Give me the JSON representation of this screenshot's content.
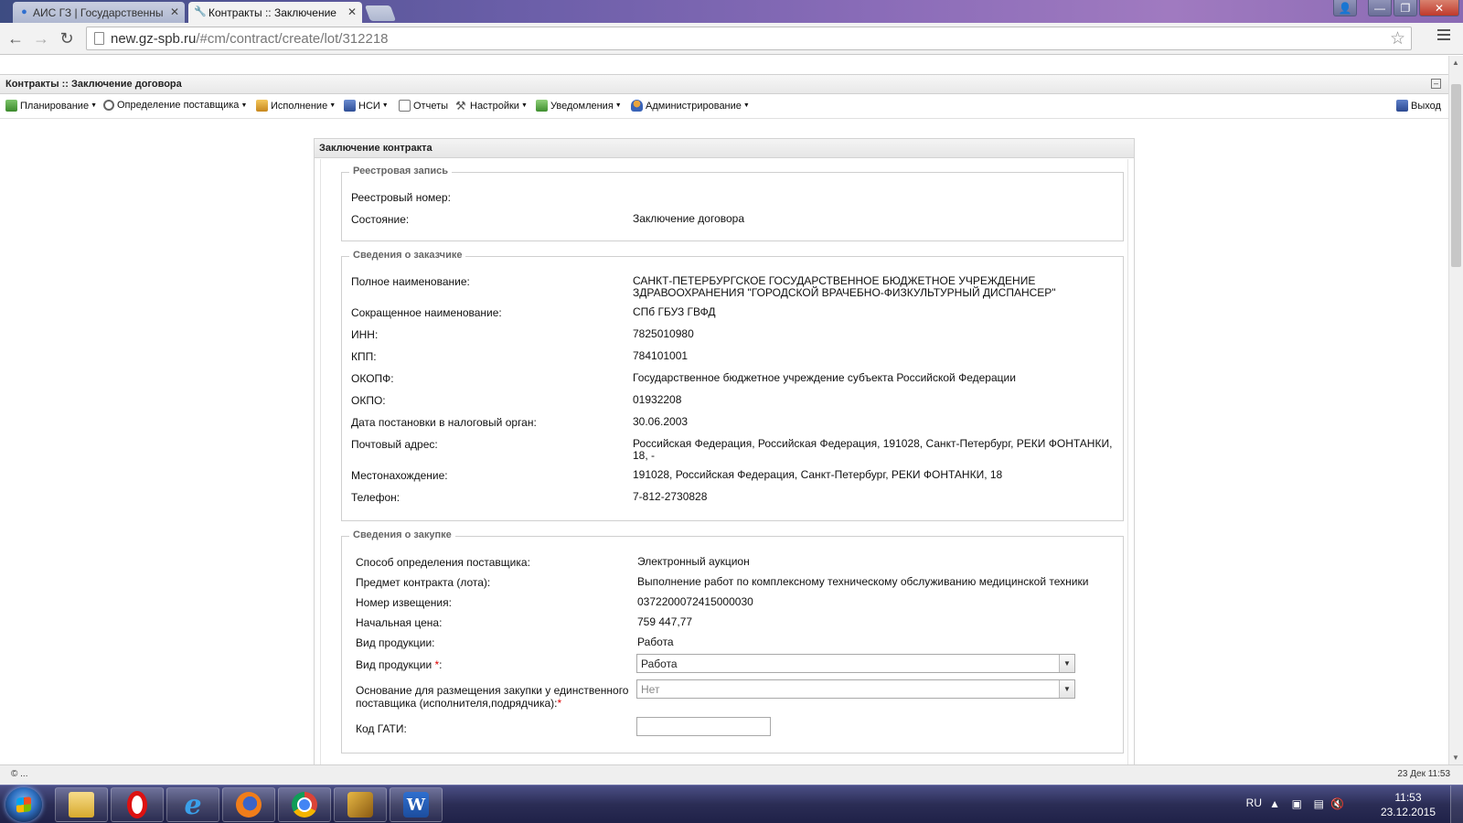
{
  "browser": {
    "tabs": [
      {
        "title": "АИС ГЗ | Государственны",
        "favicon": "globe-icon",
        "active": false
      },
      {
        "title": "Контракты :: Заключение",
        "favicon": "wrench-icon",
        "active": true
      }
    ],
    "url_host": "new.gz-spb.ru",
    "url_path": "/#cm/contract/create/lot/312218"
  },
  "app": {
    "title": "Контракты :: Заключение договора",
    "menu": [
      {
        "label": "Планирование",
        "icon": "planning-icon"
      },
      {
        "label": "Определение поставщика",
        "icon": "gear-icon"
      },
      {
        "label": "Исполнение",
        "icon": "execution-icon"
      },
      {
        "label": "НСИ",
        "icon": "book-icon"
      },
      {
        "label": "Отчеты",
        "icon": "report-icon"
      },
      {
        "label": "Настройки",
        "icon": "wrench-icon"
      },
      {
        "label": "Уведомления",
        "icon": "notification-icon"
      },
      {
        "label": "Администрирование",
        "icon": "user-icon"
      }
    ],
    "exit_label": "Выход"
  },
  "form": {
    "title": "Заключение контракта",
    "registry": {
      "legend": "Реестровая запись",
      "number_label": "Реестровый номер:",
      "number_value": "",
      "state_label": "Состояние:",
      "state_value": "Заключение договора"
    },
    "customer": {
      "legend": "Сведения о заказчике",
      "rows": [
        {
          "label": "Полное наименование:",
          "value": "САНКТ-ПЕТЕРБУРГСКОЕ ГОСУДАРСТВЕННОЕ БЮДЖЕТНОЕ УЧРЕЖДЕНИЕ ЗДРАВООХРАНЕНИЯ \"ГОРОДСКОЙ ВРАЧЕБНО-ФИЗКУЛЬТУРНЫЙ ДИСПАНСЕР\""
        },
        {
          "label": "Сокращенное наименование:",
          "value": "СПб ГБУЗ ГВФД"
        },
        {
          "label": "ИНН:",
          "value": "7825010980"
        },
        {
          "label": "КПП:",
          "value": "784101001"
        },
        {
          "label": "ОКОПФ:",
          "value": "Государственное бюджетное учреждение субъекта Российской Федерации"
        },
        {
          "label": "ОКПО:",
          "value": "01932208"
        },
        {
          "label": "Дата постановки в налоговый орган:",
          "value": "30.06.2003"
        },
        {
          "label": "Почтовый адрес:",
          "value": "Российская Федерация, Российская Федерация, 191028, Санкт-Петербург, РЕКИ ФОНТАНКИ, 18, -"
        },
        {
          "label": "Местонахождение:",
          "value": "191028, Российская Федерация, Санкт-Петербург, РЕКИ ФОНТАНКИ, 18"
        },
        {
          "label": "Телефон:",
          "value": "7-812-2730828"
        }
      ]
    },
    "procurement": {
      "legend": "Сведения о закупке",
      "rows": [
        {
          "label": "Способ определения поставщика:",
          "value": "Электронный аукцион"
        },
        {
          "label": "Предмет контракта (лота):",
          "value": "Выполнение работ по комплексному техническому обслуживанию медицинской техники"
        },
        {
          "label": "Номер извещения:",
          "value": "0372200072415000030"
        },
        {
          "label": "Начальная цена:",
          "value": "759 447,77"
        },
        {
          "label": "Вид продукции:",
          "value": "Работа"
        }
      ],
      "product_type_label": "Вид продукции ",
      "product_type_value": "Работа",
      "basis_label": "Основание для размещения закупки у единственного поставщика (исполнителя,подрядчика):",
      "basis_value": "Нет",
      "gati_label": "Код ГАТИ:",
      "gati_value": "",
      "required_mark": "*",
      "colon": ":"
    }
  },
  "statusbar": {
    "left": "© ...",
    "right": "23 Дек 11:53"
  },
  "taskbar": {
    "language": "RU",
    "time": "11:53",
    "date": "23.12.2015"
  },
  "colors": {
    "required": "#dd0000",
    "legend": "#666666"
  }
}
